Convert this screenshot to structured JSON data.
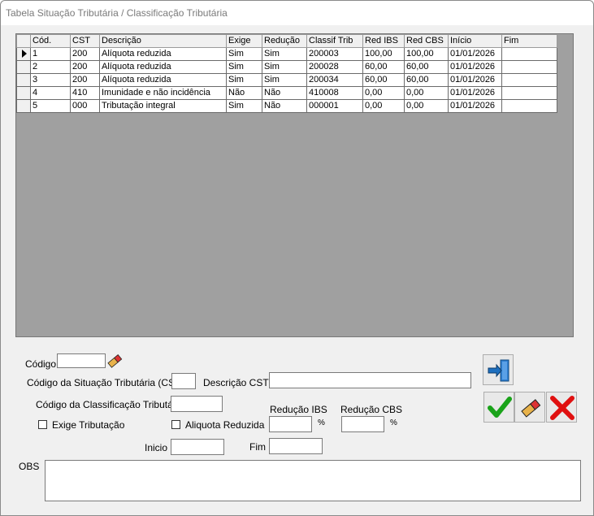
{
  "window": {
    "title": "Tabela Situação Tributária / Classificação Tributária"
  },
  "grid": {
    "columns": [
      "Cód.",
      "CST",
      "Descrição",
      "Exige",
      "Redução",
      "Classif Trib",
      "Red IBS",
      "Red CBS",
      "Início",
      "Fim"
    ],
    "rows": [
      [
        "1",
        "200",
        "Alíquota reduzida",
        "Sim",
        "Sim",
        "200003",
        "100,00",
        "100,00",
        "01/01/2026",
        ""
      ],
      [
        "2",
        "200",
        "Alíquota reduzida",
        "Sim",
        "Sim",
        "200028",
        "60,00",
        "60,00",
        "01/01/2026",
        ""
      ],
      [
        "3",
        "200",
        "Alíquota reduzida",
        "Sim",
        "Sim",
        "200034",
        "60,00",
        "60,00",
        "01/01/2026",
        ""
      ],
      [
        "4",
        "410",
        "Imunidade e não incidência",
        "Não",
        "Não",
        "410008",
        "0,00",
        "0,00",
        "01/01/2026",
        ""
      ],
      [
        "5",
        "000",
        "Tributação integral",
        "Sim",
        "Não",
        "000001",
        "0,00",
        "0,00",
        "01/01/2026",
        ""
      ]
    ],
    "current_row": 1
  },
  "form": {
    "codigo_label": "Código",
    "cst_label": "Código da Situação Tributária (CST)",
    "descricao_cst_label": "Descrição CST",
    "classificacao_label": "Código da Classificação Tributária",
    "reducao_ibs_label": "Redução IBS",
    "reducao_cbs_label": "Redução CBS",
    "exige_tributacao_label": "Exige Tributação",
    "aliquota_reduzida_label": "Aliquota Reduzida",
    "percent_symbol": "%",
    "inicio_label": "Inicio",
    "fim_label": "Fim",
    "obs_label": "OBS"
  },
  "icons": {
    "eraser": "eraser-icon",
    "exit": "exit-door-icon",
    "confirm": "checkmark-icon",
    "clear": "eraser-icon",
    "cancel": "x-cancel-icon"
  },
  "colors": {
    "confirm": "#1aa31a",
    "cancel": "#e01010",
    "exit": "#1e73c8"
  }
}
